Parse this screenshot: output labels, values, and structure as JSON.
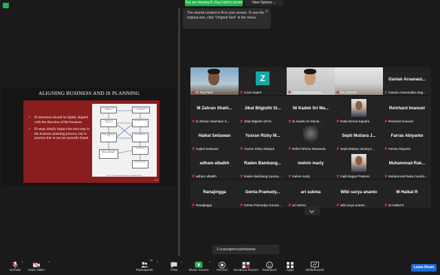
{
  "header": {
    "viewing_label": "You are viewing R. Ray Fahri's screen",
    "view_options_label": "View Options ⌄"
  },
  "tooltip": {
    "text": "The shared content is fit to your screen. To see the original size, click \"Original Size\" in the menu.",
    "close": "×"
  },
  "slide": {
    "title": "ALIGNING BUSINESS AND IS PLANNING",
    "bullets": [
      "IS decisions should be tightly aligned with the direction of the business",
      "IS steps ideally impact the next step in the business planning process, but in practice this is not yet typically found"
    ],
    "diagram_boxes": [
      "Assessment of the Business",
      "Current Information Resources",
      "Vision for the Business",
      "Information Vision",
      "Business Strategic Plan",
      "IS Architecture",
      "Business Operational Plans and Budgets",
      "Strategic Plan",
      "Operational Plan"
    ],
    "caption": "Fig 13.1 The Information Resources Planning Process",
    "page": "13-2"
  },
  "participants": [
    {
      "big": "",
      "small": "R. Raj Fahri",
      "video": "person"
    },
    {
      "big": "",
      "small": "zoom baa04",
      "video": "avatar",
      "avatar_letter": "Z"
    },
    {
      "big": "",
      "small": "Daniel Helmi Baihaqi",
      "video": "person"
    },
    {
      "big": "",
      "small": "lee_kamran",
      "video": "room"
    },
    {
      "big": "Gavian Arsanaut...",
      "small": "Gavian Arsanautika Alug...",
      "video": "none"
    },
    {
      "big": "M Zahran Shahi...",
      "small": "M Zahran Shahidan S...",
      "video": "none"
    },
    {
      "big": "Jibal Bilgisthi Sl...",
      "small": "Jibal Bilgisthi SIF21",
      "video": "none"
    },
    {
      "big": "Ni Kadek Sri Ma...",
      "small": "Ni Kadek Sri Manik...",
      "video": "none"
    },
    {
      "big": "",
      "small": "Raka Dimas Saputra",
      "video": "photo"
    },
    {
      "big": "Reinhard Imanuel",
      "small": "Reinhard imanuel",
      "video": "none"
    },
    {
      "big": "Haikal Setiawan",
      "small": "Haikal Setiawan",
      "video": "none"
    },
    {
      "big": "Yusran Rizky M...",
      "small": "Yusran Rizky Mulyadi",
      "video": "none"
    },
    {
      "big": "",
      "small": "Refal Fahriza Ramanda",
      "video": "dark"
    },
    {
      "big": "Septi Mutiara J...",
      "small": "Septi Mutiara Janing K...",
      "video": "none"
    },
    {
      "big": "Farras Abiyanto",
      "small": "Farras Abiyanto",
      "video": "none"
    },
    {
      "big": "adham albalkh",
      "small": "adham albalkh",
      "video": "none"
    },
    {
      "big": "Raden Bambang...",
      "small": "Raden Bambang Syuma...",
      "video": "none"
    },
    {
      "big": "melvin marly",
      "small": "melvin marly",
      "video": "none"
    },
    {
      "big": "",
      "small": "Fajih Bagas Prakoso",
      "video": "photo"
    },
    {
      "big": "Muhammad Rak...",
      "small": "Muhammad Raka Candra...",
      "video": "none"
    },
    {
      "big": "Ranajingga",
      "small": "Ranajingga",
      "video": "none"
    },
    {
      "big": "Genta Pramudy...",
      "small": "Genta Pramudya Gunaw...",
      "video": "none"
    },
    {
      "big": "ari sukma",
      "small": "ari sukma",
      "video": "none"
    },
    {
      "big": "Wibi surya ananto",
      "small": "wibi surya ananto",
      "video": "none"
    },
    {
      "big": "M Haikal R",
      "small": "M Haikal R",
      "video": "none"
    }
  ],
  "unassigned_label": "3 unassigned participants",
  "toolbar": {
    "unmute": "Unmute",
    "start_video": "Start Video",
    "participants": "Participants",
    "participants_count": "26",
    "chat": "Chat",
    "share_screen": "Share Screen",
    "record": "Record",
    "breakout_rooms": "Breakout Rooms",
    "reactions": "Reactions",
    "apps": "Apps",
    "whiteboards": "Whiteboards",
    "leave": "Leave Room"
  },
  "colors": {
    "accent_green": "#23b24b",
    "slide_red": "#8a1d1d",
    "leave_blue": "#1f6bd8",
    "active_speaker": "#d6ce19"
  }
}
